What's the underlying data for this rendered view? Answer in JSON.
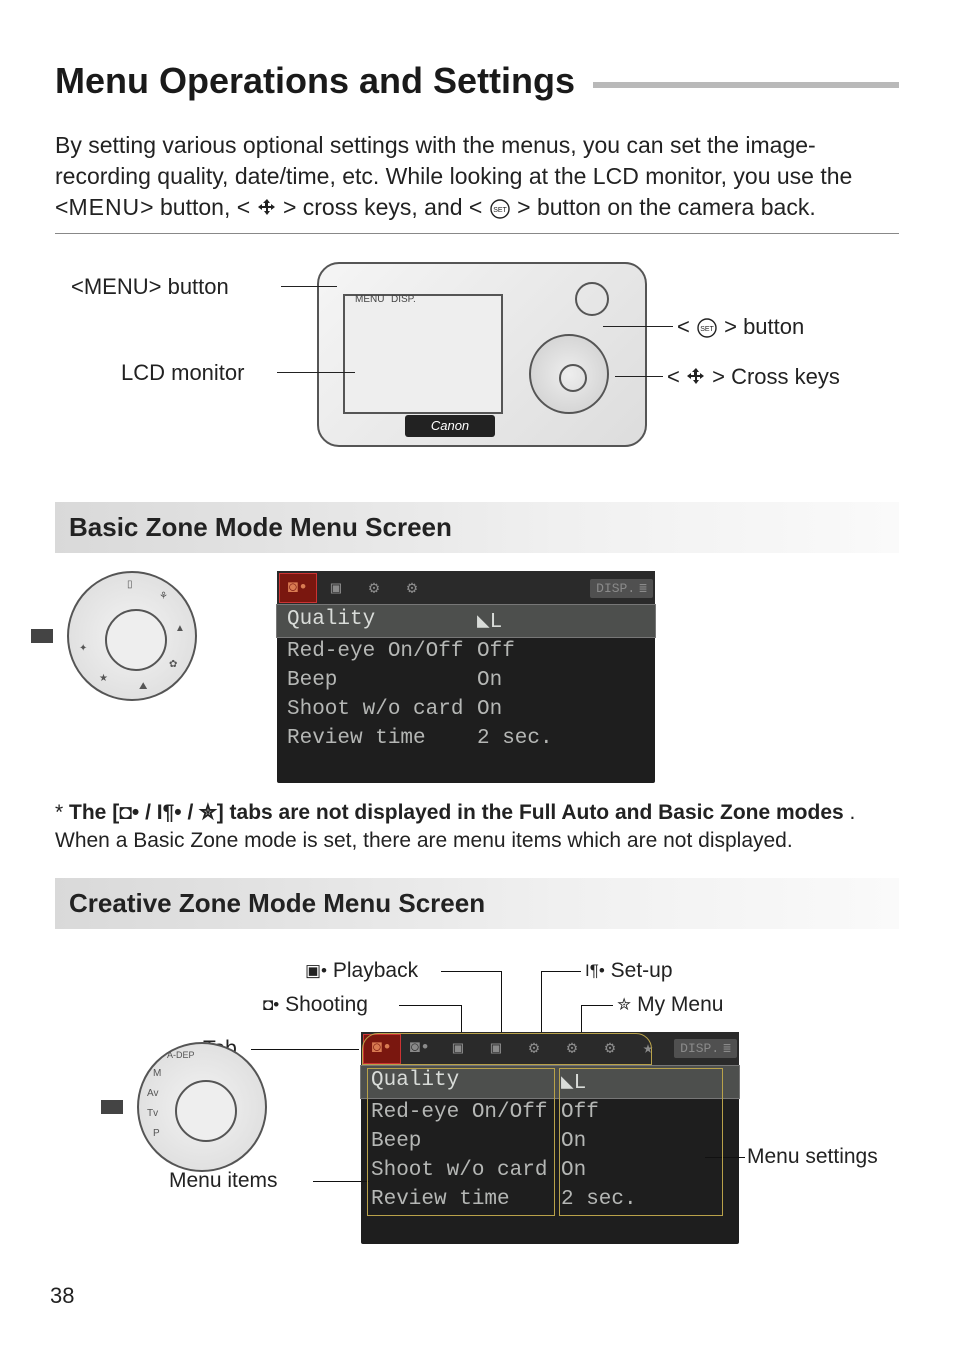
{
  "page_number": "38",
  "title": "Menu Operations and Settings",
  "intro_line1": "By setting various optional settings with the menus, you can set the image-",
  "intro_line2": "recording quality, date/time, etc. While looking at the LCD monitor, you use the",
  "intro_line3_pre": "<",
  "intro_menu": "MENU",
  "intro_line3_mid1": "> button, <",
  "intro_line3_mid2": "> cross keys, and <",
  "intro_line3_post": "> button on the camera back.",
  "cam": {
    "logo": "Canon",
    "menu_btn_label": "<MENU> button",
    "lcd_label": "LCD monitor",
    "set_btn_label_pre": "<",
    "set_btn_label_post": "> button",
    "cross_label_pre": "<",
    "cross_label_post": "> Cross keys",
    "tiny_menu": "MENU",
    "tiny_disp": "DISP."
  },
  "basic_head": "Basic Zone Mode Menu Screen",
  "lcd_menu": {
    "disp_badge": "DISP.",
    "rows": [
      {
        "k": "Quality",
        "v": "◣L",
        "sel": true
      },
      {
        "k": "Red-eye On/Off",
        "v": "Off"
      },
      {
        "k": "Beep",
        "v": "On"
      },
      {
        "k": "Shoot w/o card",
        "v": "On"
      },
      {
        "k": "Review time",
        "v": "2 sec."
      }
    ]
  },
  "note_star": "*",
  "note_bold_pre": "The [",
  "note_bold_post": "] tabs are not displayed in the Full Auto and Basic Zone modes",
  "note_rest": ". When a Basic Zone mode is set, there are menu items which are not displayed.",
  "creative_head": "Creative Zone Mode Menu Screen",
  "creative_labels": {
    "playback": "Playback",
    "shooting": "Shooting",
    "setup": "Set-up",
    "mymenu": "My Menu",
    "tab": "Tab",
    "menu_items": "Menu items",
    "menu_settings": "Menu settings"
  },
  "playback_icon": "▣•",
  "shooting_icon": "◘•",
  "setup_icon": "І¶•",
  "mymenu_icon": "✮",
  "note_icons": "◘• / І¶• / ✮"
}
